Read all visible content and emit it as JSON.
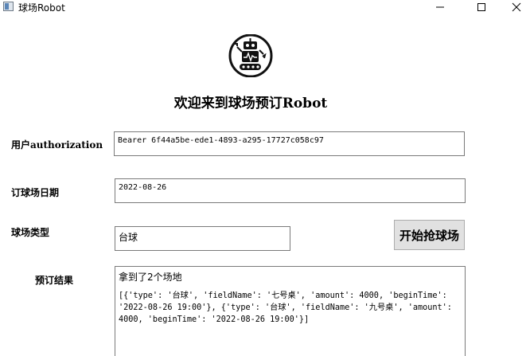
{
  "window": {
    "title": "球场Robot",
    "minimize_label": "—",
    "maximize_label": "☐",
    "close_label": "✕"
  },
  "header": {
    "logo_icon": "robot-icon",
    "welcome": "欢迎来到球场预订Robot"
  },
  "form": {
    "authorization": {
      "label": "用户authorization",
      "value": "Bearer 6f44a5be-ede1-4893-a295-17727c058c97"
    },
    "date": {
      "label": "订球场日期",
      "value": "2022-08-26"
    },
    "court_type": {
      "label": "球场类型",
      "value": "台球"
    },
    "start_button": "开始抢球场",
    "result": {
      "label": "预订结果",
      "line1": "拿到了2个场地",
      "line2": "[{'type': '台球', 'fieldName': '七号桌', 'amount': 4000, 'beginTime': '2022-08-26 19:00'}, {'type': '台球', 'fieldName': '九号桌', 'amount': 4000, 'beginTime': '2022-08-26 19:00'}]"
    }
  },
  "colors": {
    "button_bg": "#e1e1e1",
    "field_border": "#7a7a7a"
  }
}
